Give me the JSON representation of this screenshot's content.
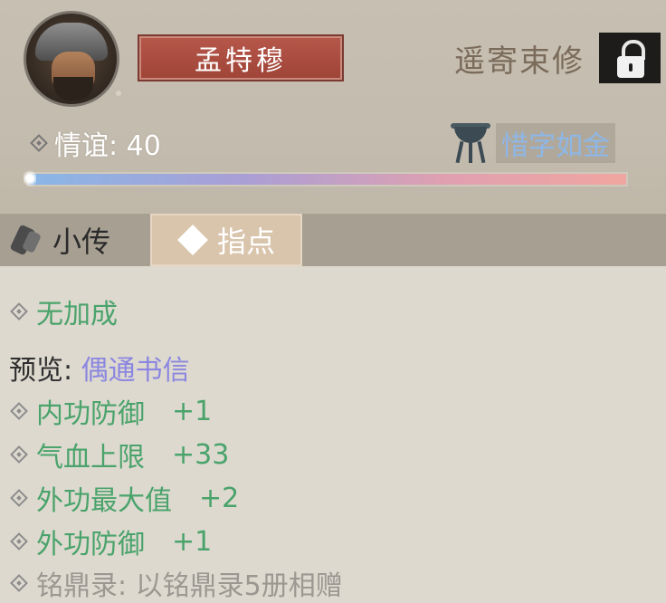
{
  "header": {
    "character_name": "孟特穆",
    "send_letter_label": "遥寄束修",
    "affinity_label": "情谊: 40",
    "affinity_level": 0.0,
    "gift_label": "惜字如金"
  },
  "tabs": [
    {
      "label": "小传",
      "active": false
    },
    {
      "label": "指点",
      "active": true
    }
  ],
  "bonus": {
    "current": "无加成",
    "preview_prefix": "预览: ",
    "preview_name": "偶通书信",
    "stats": [
      {
        "name": "内功防御",
        "value": "+1"
      },
      {
        "name": "气血上限",
        "value": "+33"
      },
      {
        "name": "外功最大值",
        "value": "+2"
      },
      {
        "name": "外功防御",
        "value": "+1"
      }
    ],
    "condition": "铭鼎录: 以铭鼎录5册相赠"
  },
  "colors": {
    "accent_green": "#4aa36b",
    "link_purple": "#8b86e0",
    "name_plate_red": "#a9483b"
  }
}
